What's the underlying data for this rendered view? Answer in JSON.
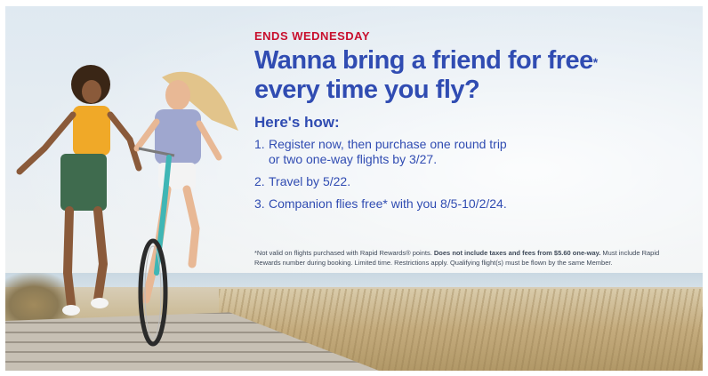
{
  "promo": {
    "eyebrow": "ENDS WEDNESDAY",
    "headline_line1": "Wanna bring a friend for free",
    "headline_mark": "*",
    "headline_line2": "every time you fly?",
    "subhead": "Here's how:",
    "steps": [
      {
        "num": "1.",
        "line1": "Register now, then purchase one round trip",
        "line2": "or two one-way flights by 3/27."
      },
      {
        "num": "2.",
        "line1": "Travel by 5/22."
      },
      {
        "num": "3.",
        "line1": "Companion flies free* with you 8/5-10/2/24."
      }
    ],
    "disclaimer_part1": "*Not valid on flights purchased with Rapid Rewards® points.",
    "disclaimer_bold": "Does not include taxes and fees from $5.60 one-way.",
    "disclaimer_part2": "Must include Rapid Rewards number during booking. Limited time. Restrictions apply. Qualifying flight(s) must be flown by the same Member."
  },
  "colors": {
    "accent_red": "#c8102e",
    "brand_blue": "#304cb2",
    "fine_print": "#3f4a5a"
  }
}
